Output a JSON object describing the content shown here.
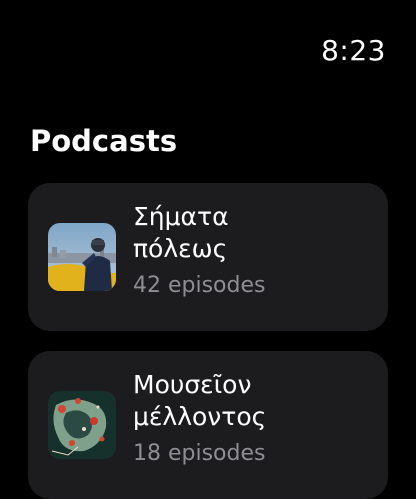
{
  "status_bar": {
    "time": "8:23"
  },
  "header": {
    "title": "Podcasts"
  },
  "podcasts": [
    {
      "title_line1": "Σήματα",
      "title_line2": "πόλεως",
      "episodes": "42 episodes",
      "artwork_icon": "city-viewpoint-artwork"
    },
    {
      "title_line1": "Μουσεῖον",
      "title_line2": "μέλλοντος",
      "episodes": "18 episodes",
      "artwork_icon": "abstract-map-artwork"
    }
  ],
  "colors": {
    "background": "#000000",
    "card": "#1c1c1e",
    "secondary_text": "#8e8e93"
  }
}
